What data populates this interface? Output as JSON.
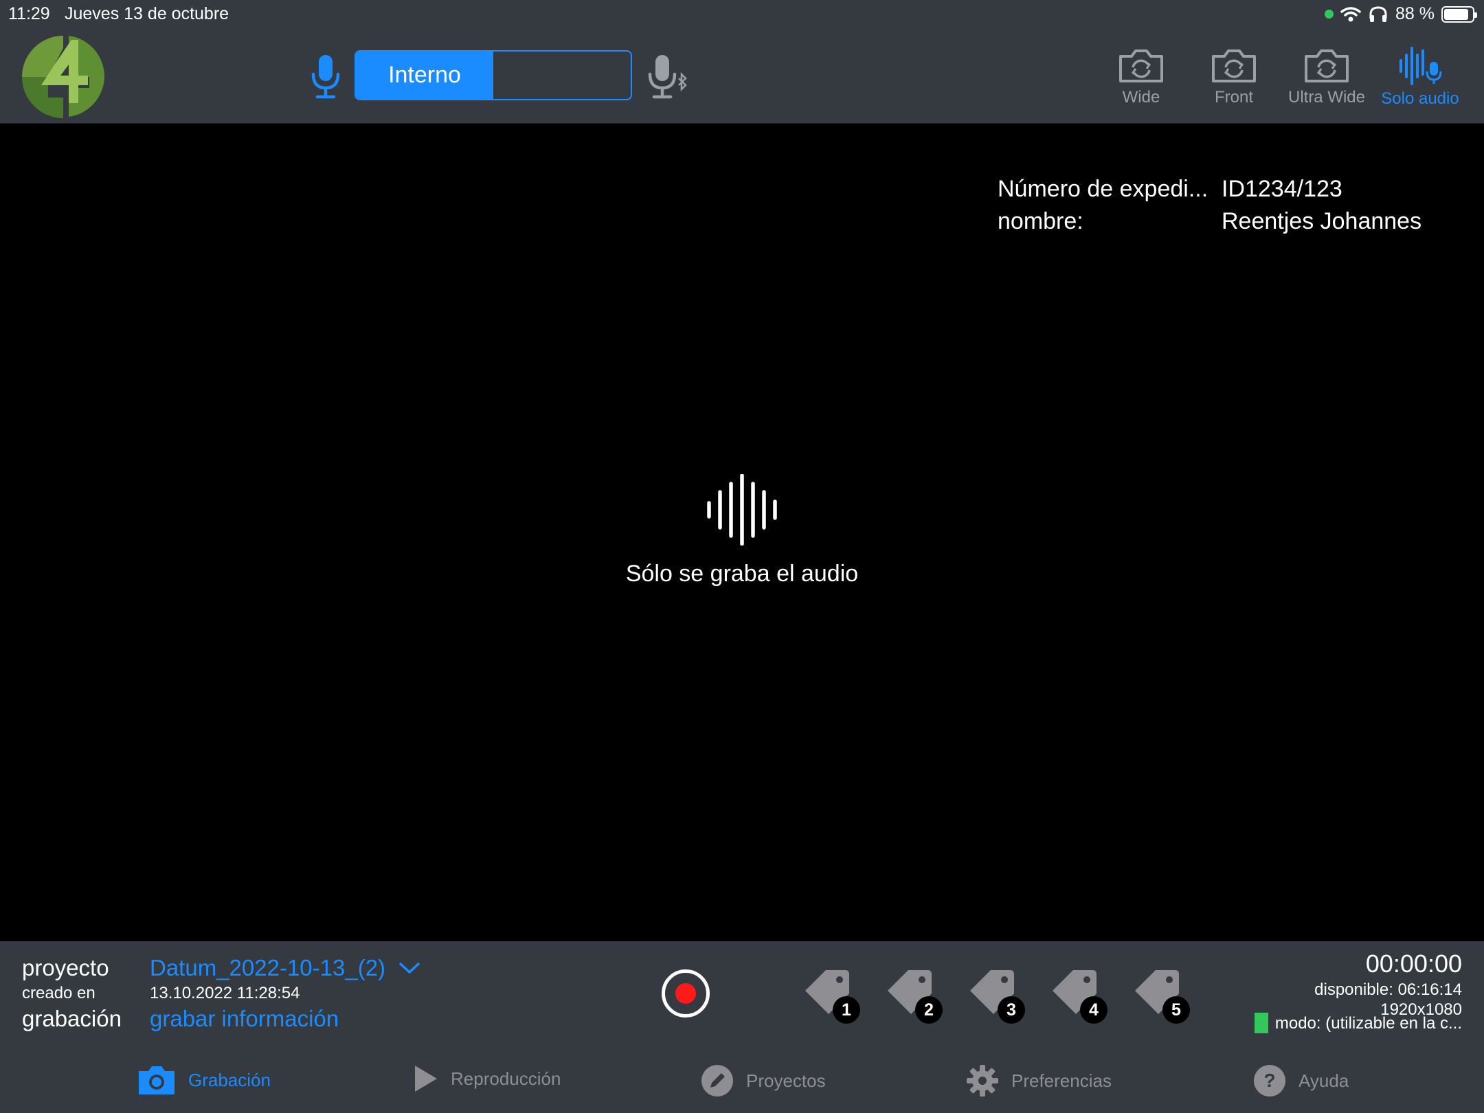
{
  "status_bar": {
    "time": "11:29",
    "date": "Jueves 13 de octubre",
    "battery_text": "88 %",
    "battery_level": 0.88
  },
  "header": {
    "audio_source_options": [
      "Interno",
      ""
    ],
    "selected_audio_source": "Interno",
    "cameras": [
      {
        "label": "Wide",
        "icon": "camera-rotate-icon",
        "active": false
      },
      {
        "label": "Front",
        "icon": "camera-rotate-icon",
        "active": false
      },
      {
        "label": "Ultra Wide",
        "icon": "camera-rotate-icon",
        "active": false
      },
      {
        "label": "Solo audio",
        "icon": "waveform-mic-icon",
        "active": true
      }
    ]
  },
  "overlay": {
    "fields": [
      {
        "key": "Número de expedi...",
        "value": "ID1234/123"
      },
      {
        "key": "nombre:",
        "value": "Reentjes Johannes"
      }
    ]
  },
  "preview": {
    "message": "Sólo se graba el audio"
  },
  "controls": {
    "project_label": "proyecto",
    "created_label": "creado en",
    "recording_label": "grabación",
    "project_name": "Datum_2022-10-13_(2)",
    "created_at": "13.10.2022 11:28:54",
    "recording_info_link": "grabar información",
    "tags": [
      "1",
      "2",
      "3",
      "4",
      "5"
    ],
    "timer": "00:00:00",
    "available": "disponible: 06:16:14",
    "resolution": "1920x1080",
    "mode": "modo: (utilizable en la c..."
  },
  "tabs": [
    {
      "label": "Grabación",
      "icon": "camera-icon",
      "active": true
    },
    {
      "label": "Reproducción",
      "icon": "play-icon",
      "active": false
    },
    {
      "label": "Proyectos",
      "icon": "pencil-icon",
      "active": false
    },
    {
      "label": "Preferencias",
      "icon": "gear-icon",
      "active": false
    },
    {
      "label": "Ayuda",
      "icon": "help-icon",
      "active": false
    }
  ],
  "colors": {
    "accent": "#1a8cff",
    "bar_background": "#343a40",
    "record": "#ff1a1a",
    "status_green": "#34c759",
    "inactive": "#8e8e93"
  }
}
